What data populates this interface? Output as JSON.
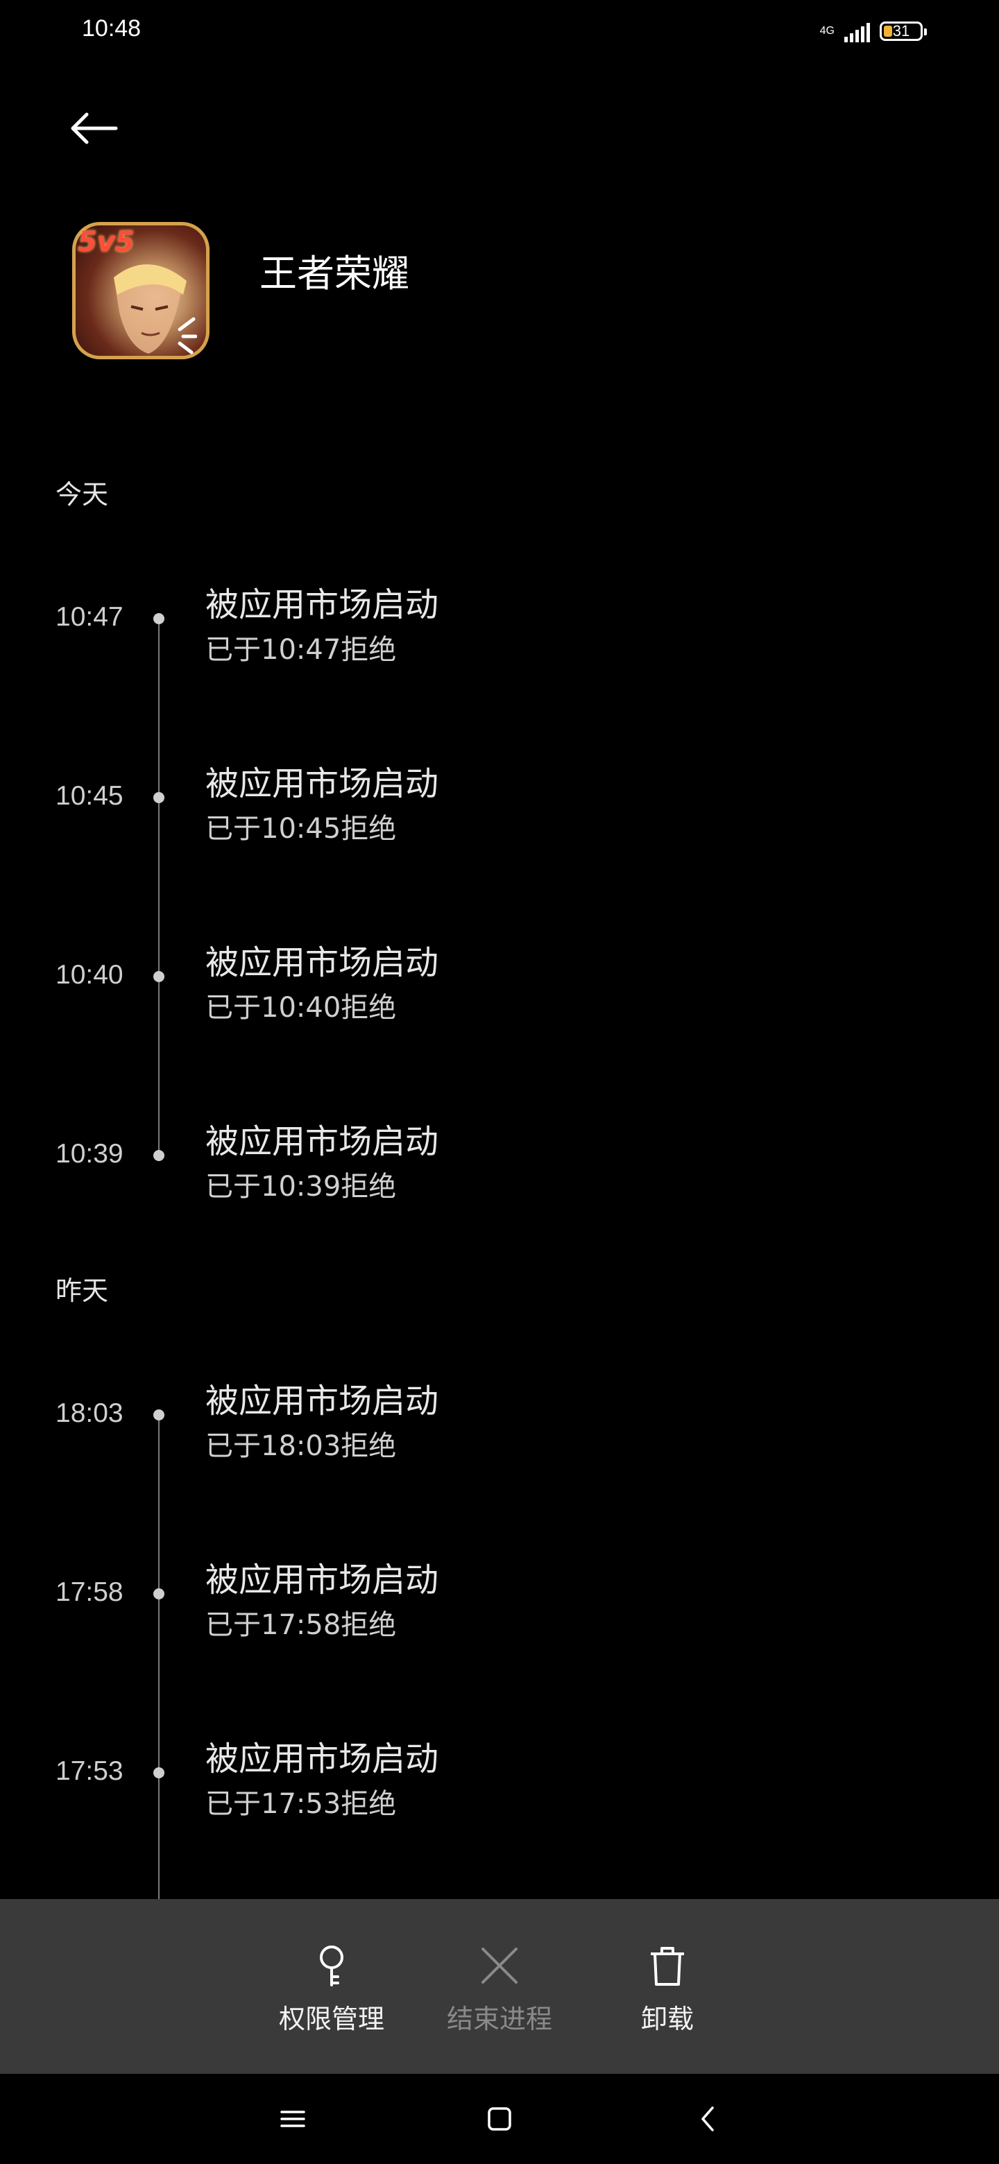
{
  "status_bar": {
    "time": "10:48",
    "network": "4G",
    "battery": "31",
    "battery_color": "#f2b13b"
  },
  "header": {
    "back_icon": "arrow-left-icon",
    "app_name": "王者荣耀",
    "app_icon_badge": "5v5"
  },
  "sections": [
    {
      "label": "今天",
      "entries": [
        {
          "time": "10:47",
          "title": "被应用市场启动",
          "subtitle": "已于10:47拒绝"
        },
        {
          "time": "10:45",
          "title": "被应用市场启动",
          "subtitle": "已于10:45拒绝"
        },
        {
          "time": "10:40",
          "title": "被应用市场启动",
          "subtitle": "已于10:40拒绝"
        },
        {
          "time": "10:39",
          "title": "被应用市场启动",
          "subtitle": "已于10:39拒绝"
        }
      ]
    },
    {
      "label": "昨天",
      "entries": [
        {
          "time": "18:03",
          "title": "被应用市场启动",
          "subtitle": "已于18:03拒绝"
        },
        {
          "time": "17:58",
          "title": "被应用市场启动",
          "subtitle": "已于17:58拒绝"
        },
        {
          "time": "17:53",
          "title": "被应用市场启动",
          "subtitle": "已于17:53拒绝"
        }
      ]
    }
  ],
  "actions": {
    "permissions": {
      "label": "权限管理",
      "icon": "key-icon"
    },
    "end_process": {
      "label": "结束进程",
      "icon": "close-icon",
      "enabled": false
    },
    "uninstall": {
      "label": "卸载",
      "icon": "trash-icon"
    }
  },
  "system_nav": {
    "menu_icon": "menu-icon",
    "home_icon": "home-square-icon",
    "back_icon": "chevron-left-icon"
  }
}
